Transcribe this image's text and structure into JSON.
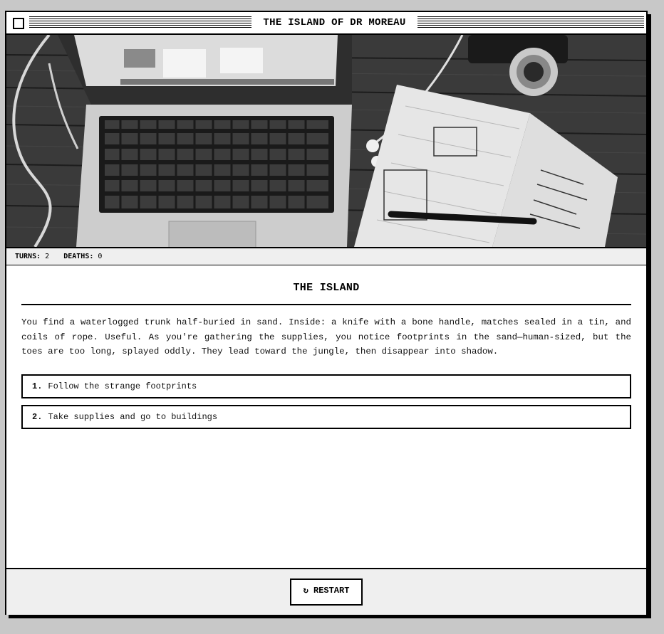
{
  "window": {
    "title": "THE ISLAND OF DR MOREAU"
  },
  "stats": {
    "turns_label": "TURNS:",
    "turns": "2",
    "deaths_label": "DEATHS:",
    "deaths": "0"
  },
  "scene": {
    "title": "THE ISLAND",
    "text": "You find a waterlogged trunk half-buried in sand. Inside: a knife with a bone handle, matches sealed in a tin, and coils of rope. Useful. As you're gathering the supplies, you notice footprints in the sand—human-sized, but the toes are too long, splayed oddly. They lead toward the jungle, then disappear into shadow."
  },
  "choices": [
    {
      "num": "1.",
      "label": "Follow the strange footprints"
    },
    {
      "num": "2.",
      "label": "Take supplies and go to buildings"
    }
  ],
  "footer": {
    "restart_icon": "↻",
    "restart_label": "RESTART"
  }
}
